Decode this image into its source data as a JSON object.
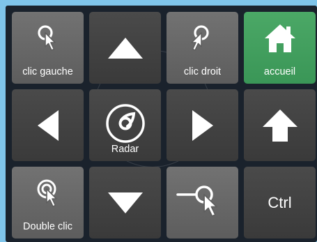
{
  "keys": {
    "left_click": {
      "label": "clic gauche",
      "icon": "click-cursor-icon"
    },
    "up": {
      "icon": "triangle-up-icon"
    },
    "right_click": {
      "label": "clic droit",
      "icon": "click-cursor-icon"
    },
    "home": {
      "label": "accueil",
      "icon": "home-icon"
    },
    "left": {
      "icon": "triangle-left-icon"
    },
    "radar": {
      "label": "Radar",
      "icon": "radar-icon"
    },
    "right": {
      "icon": "triangle-right-icon"
    },
    "shift": {
      "icon": "arrow-up-icon"
    },
    "double_click": {
      "label": "Double clic",
      "icon": "double-click-cursor-icon"
    },
    "down": {
      "icon": "triangle-down-icon"
    },
    "drag": {
      "icon": "drag-cursor-icon"
    },
    "ctrl": {
      "label": "Ctrl"
    }
  },
  "colors": {
    "background": "#7fc4ea",
    "panel": "#1a222c",
    "key_light": "#686868",
    "key_dark": "#434343",
    "accent_green": "#44a35f"
  }
}
